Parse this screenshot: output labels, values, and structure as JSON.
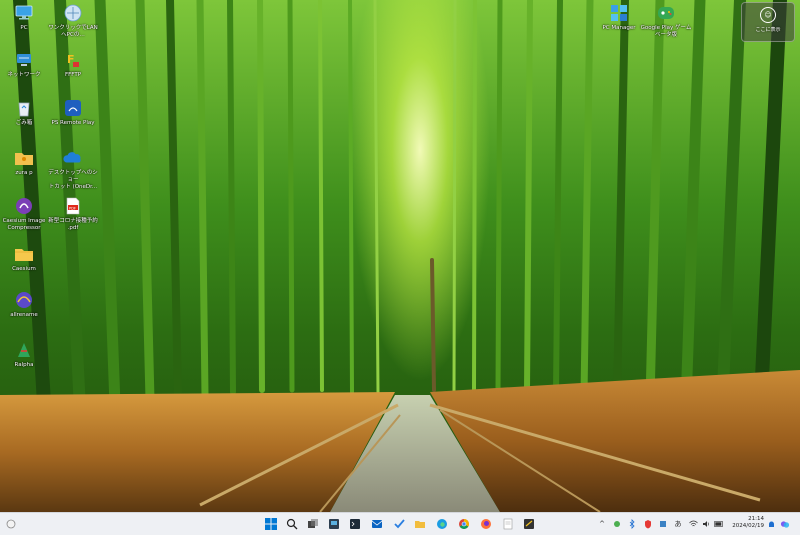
{
  "desktop_icons": [
    {
      "name": "pc-icon",
      "label": "PC"
    },
    {
      "name": "document-icon",
      "label": "ワンクリックでLAN\nへPCの…"
    },
    {
      "name": "network-icon",
      "label": "ネットワーク"
    },
    {
      "name": "ftp-icon",
      "label": "FFFTP"
    },
    {
      "name": "recycle-bin-icon",
      "label": "ごみ箱"
    },
    {
      "name": "remote-play-icon",
      "label": "PS Remote Play"
    },
    {
      "name": "folder-user-icon",
      "label": "zura p"
    },
    {
      "name": "onedrive-icon",
      "label": "デスクトップへのショー\nトカット (OneDr..."
    },
    {
      "name": "caesium-app-icon",
      "label": "Caesium Image\nCompressor"
    },
    {
      "name": "pdf-icon",
      "label": "新型コロナ接種予約\n.pdf"
    },
    {
      "name": "folder-icon",
      "label": "Caesium"
    },
    {
      "name": "allrename-icon",
      "label": "allrename"
    },
    {
      "name": "ralpha-icon",
      "label": "Ralpha"
    },
    {
      "name": "pc-manager-icon",
      "label": "PC Manager"
    },
    {
      "name": "google-play-games-icon",
      "label": "Google Play ゲーム\nベータ版"
    }
  ],
  "widget": {
    "label": "ここに表示"
  },
  "clock": {
    "time": "21:14",
    "date": "2024/02/19"
  },
  "tray": {
    "ime": "あ",
    "chevron": "^"
  },
  "colors": {
    "taskbar": "#eef0f4",
    "accent": "#0078d4"
  }
}
